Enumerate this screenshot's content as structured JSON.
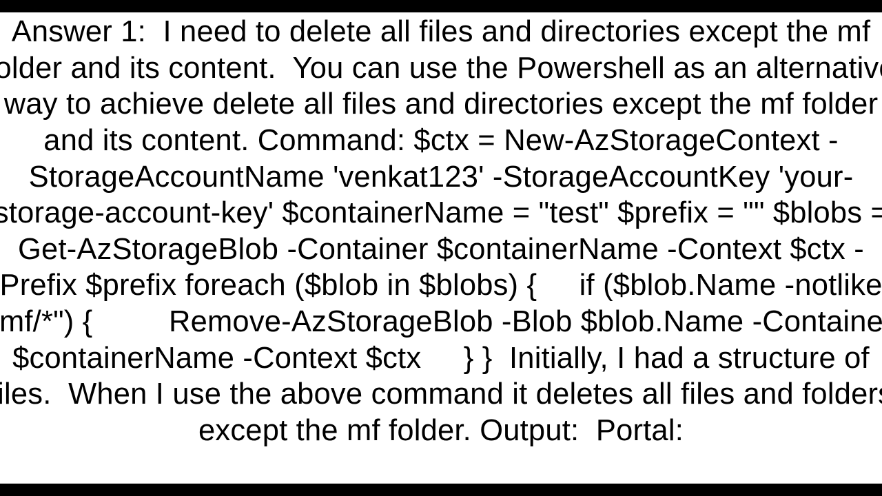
{
  "answer": {
    "text": "Answer 1:  I need to delete all files and directories except the mf folder and its content.  You can use the Powershell as an alternative way to achieve delete all files and directories except the mf folder and its content. Command: $ctx = New-AzStorageContext -StorageAccountName 'venkat123' -StorageAccountKey 'your-storage-account-key' $containerName = \"test\" $prefix = \"\" $blobs = Get-AzStorageBlob -Container $containerName -Context $ctx -Prefix $prefix foreach ($blob in $blobs) {     if ($blob.Name -notlike \"mf/*\") {         Remove-AzStorageBlob -Blob $blob.Name -Container $containerName -Context $ctx     } }  Initially, I had a structure of files.  When I use the above command it deletes all files and folders except the mf folder. Output:  Portal:"
  }
}
